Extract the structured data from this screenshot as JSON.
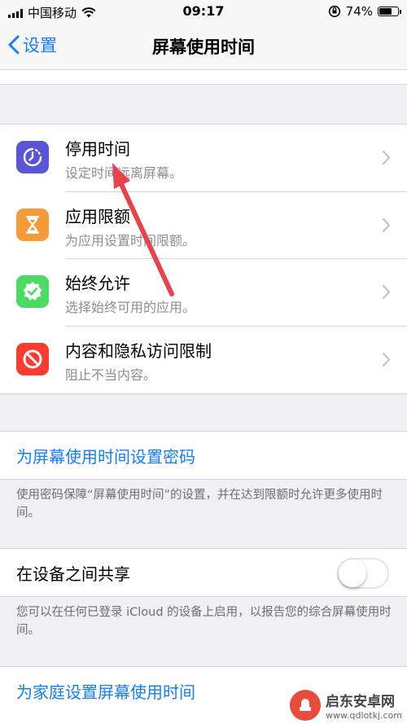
{
  "status": {
    "carrier": "中国移动",
    "time": "09:17",
    "battery": "74%",
    "battery_level": 0.74
  },
  "nav": {
    "back_label": "设置",
    "title": "屏幕使用时间"
  },
  "menu": [
    {
      "title": "停用时间",
      "subtitle": "设定时间远离屏幕。",
      "icon": "downtime-icon",
      "color": "#5856d6"
    },
    {
      "title": "应用限额",
      "subtitle": "为应用设置时间限额。",
      "icon": "hourglass-icon",
      "color": "#f29b38"
    },
    {
      "title": "始终允许",
      "subtitle": "选择始终可用的应用。",
      "icon": "checkmark-badge-icon",
      "color": "#4cd964"
    },
    {
      "title": "内容和隐私访问限制",
      "subtitle": "阻止不当内容。",
      "icon": "no-entry-icon",
      "color": "#ff3b30"
    }
  ],
  "passcode": {
    "label": "为屏幕使用时间设置密码",
    "footnote": "使用密码保障“屏幕使用时间”的设置，并在达到限额时允许更多使用时间。"
  },
  "share": {
    "label": "在设备之间共享",
    "enabled": false,
    "footnote": "您可以在任何已登录 iCloud 的设备上启用，以报告您的综合屏幕使用时间。"
  },
  "family": {
    "label": "为家庭设置屏幕使用时间"
  },
  "watermark": {
    "name": "启东安卓网",
    "url": "www.qdlotkj.com"
  }
}
